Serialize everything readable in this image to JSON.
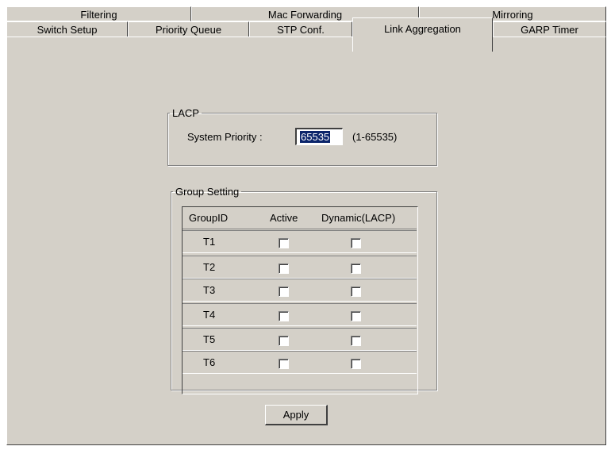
{
  "tabs": {
    "row1": [
      {
        "label": "Filtering"
      },
      {
        "label": "Mac Forwarding"
      },
      {
        "label": "Mirroring"
      }
    ],
    "row2": [
      {
        "label": "Switch Setup"
      },
      {
        "label": "Priority Queue"
      },
      {
        "label": "STP Conf."
      },
      {
        "label": "Link Aggregation"
      },
      {
        "label": "GARP Timer"
      }
    ],
    "active": "Link Aggregation"
  },
  "lacp": {
    "title": "LACP",
    "system_priority_label": "System Priority :",
    "system_priority_value": "65535",
    "system_priority_range": "(1-65535)"
  },
  "group_setting": {
    "title": "Group Setting",
    "columns": [
      "GroupID",
      "Active",
      "Dynamic(LACP)"
    ],
    "rows": [
      {
        "id": "T1",
        "active": false,
        "dynamic": false
      },
      {
        "id": "T2",
        "active": false,
        "dynamic": false
      },
      {
        "id": "T3",
        "active": false,
        "dynamic": false
      },
      {
        "id": "T4",
        "active": false,
        "dynamic": false
      },
      {
        "id": "T5",
        "active": false,
        "dynamic": false
      },
      {
        "id": "T6",
        "active": false,
        "dynamic": false
      }
    ]
  },
  "apply_label": "Apply",
  "colors": {
    "panel": "#d4d0c8",
    "selection": "#0a246a"
  }
}
